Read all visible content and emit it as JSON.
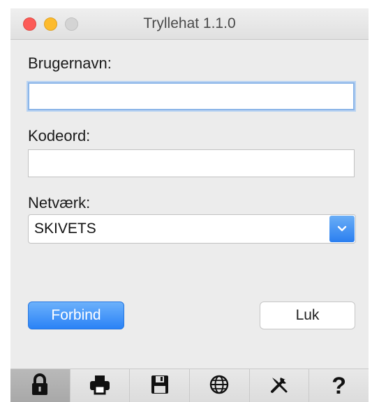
{
  "window": {
    "title": "Tryllehat 1.1.0",
    "traffic_lights": [
      "close",
      "minimize",
      "zoom"
    ]
  },
  "form": {
    "username": {
      "label": "Brugernavn:",
      "value": ""
    },
    "password": {
      "label": "Kodeord:",
      "value": ""
    },
    "network": {
      "label": "Netværk:",
      "selected": "SKIVETS"
    }
  },
  "buttons": {
    "connect_label": "Forbind",
    "close_label": "Luk"
  },
  "toolbar": {
    "items": [
      {
        "icon": "lock-icon",
        "active": true
      },
      {
        "icon": "printer-icon",
        "active": false
      },
      {
        "icon": "save-icon",
        "active": false
      },
      {
        "icon": "globe-icon",
        "active": false
      },
      {
        "icon": "tools-icon",
        "active": false
      },
      {
        "icon": "help-icon",
        "glyph": "?",
        "active": false
      }
    ]
  },
  "colors": {
    "accent": "#2a82f6",
    "focus_ring": "#8bb5e8",
    "close_light": "#fc5b57",
    "minimize_light": "#fdbb2d",
    "zoom_light": "#d4d4d4"
  }
}
